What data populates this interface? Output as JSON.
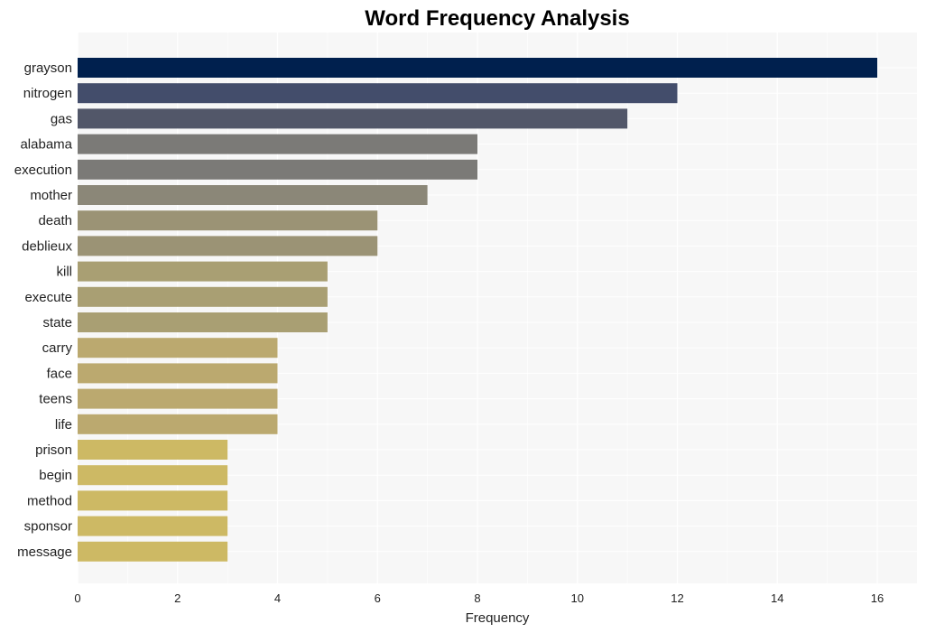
{
  "chart_data": {
    "type": "bar",
    "orientation": "horizontal",
    "title": "Word Frequency Analysis",
    "xlabel": "Frequency",
    "ylabel": "",
    "xlim": [
      0,
      16.8
    ],
    "xticks": [
      0,
      2,
      4,
      6,
      8,
      10,
      12,
      14,
      16
    ],
    "grid": true,
    "legend": "none",
    "categories": [
      "grayson",
      "nitrogen",
      "gas",
      "alabama",
      "execution",
      "mother",
      "death",
      "deblieux",
      "kill",
      "execute",
      "state",
      "carry",
      "face",
      "teens",
      "life",
      "prison",
      "begin",
      "method",
      "sponsor",
      "message"
    ],
    "values": [
      16,
      12,
      11,
      8,
      8,
      7,
      6,
      6,
      5,
      5,
      5,
      4,
      4,
      4,
      4,
      3,
      3,
      3,
      3,
      3
    ],
    "colors": [
      "#00204e",
      "#434d6b",
      "#525769",
      "#7b7a77",
      "#7b7a77",
      "#8b8778",
      "#9b9375",
      "#9b9375",
      "#a99f73",
      "#a99f73",
      "#a99f73",
      "#bba96f",
      "#bba96f",
      "#bba96f",
      "#bba96f",
      "#cdb964",
      "#cdb964",
      "#cdb964",
      "#cdb964",
      "#cdb964"
    ],
    "background": "#f7f7f7",
    "gridColor": "#ffffff"
  }
}
